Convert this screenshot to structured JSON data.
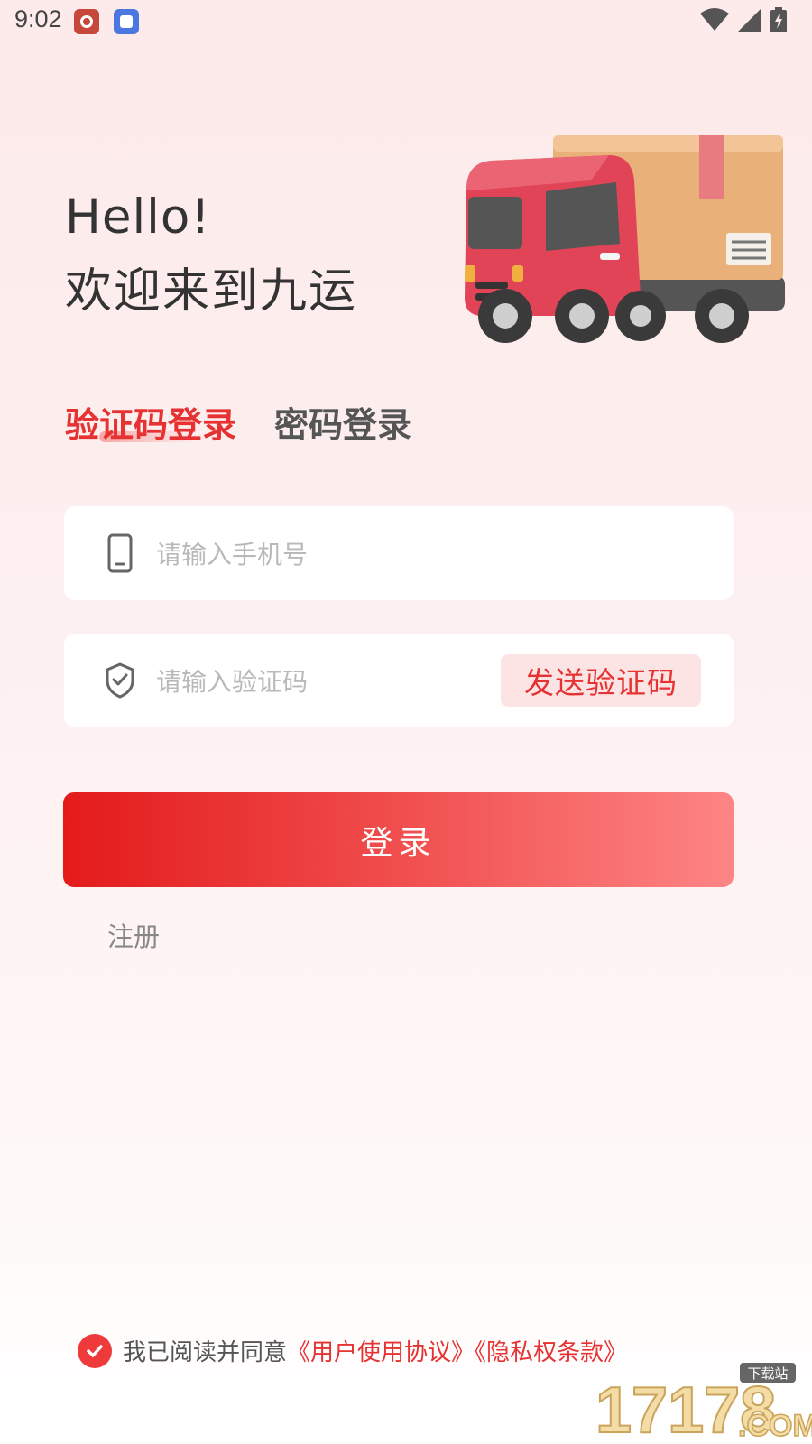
{
  "status_bar": {
    "time": "9:02"
  },
  "greeting": {
    "hello": "Hello!",
    "welcome": "欢迎来到九运"
  },
  "tabs": [
    {
      "label": "验证码登录",
      "active": true
    },
    {
      "label": "密码登录",
      "active": false
    }
  ],
  "form": {
    "phone_placeholder": "请输入手机号",
    "code_placeholder": "请输入验证码",
    "send_code_label": "发送验证码",
    "login_label": "登录",
    "register_label": "注册"
  },
  "agreement": {
    "checked": true,
    "prefix": "我已阅读并同意",
    "user_agreement": "《用户使用协议》",
    "privacy_policy": "《隐私权条款》"
  },
  "watermark": {
    "number": "17178",
    "tag": "下载站",
    "domain": ".COM"
  },
  "colors": {
    "accent": "#e63232",
    "button_start": "#e31a1a",
    "button_end": "#fd8585",
    "background": "#fdeeee"
  },
  "icons": [
    "phone-icon",
    "shield-check-icon",
    "check-icon",
    "wifi-icon",
    "signal-icon",
    "battery-icon"
  ]
}
